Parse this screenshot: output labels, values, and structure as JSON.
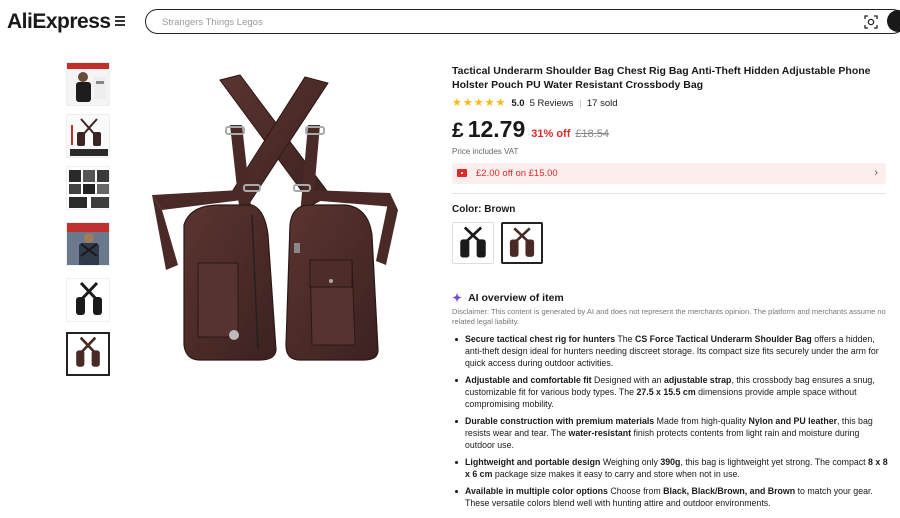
{
  "header": {
    "logo_text": "AliExpress",
    "search_placeholder": "Strangers Things Legos"
  },
  "product": {
    "title": "Tactical Underarm Shoulder Bag Chest Rig Bag Anti-Theft Hidden Adjustable Phone Holster Pouch PU Water Resistant Crossbody Bag",
    "rating": "5.0",
    "star_count": 5,
    "reviews": "5 Reviews",
    "sold": "17 sold",
    "currency": "£",
    "price": "12.79",
    "discount": "31% off",
    "original_price": "£18.54",
    "vat_note": "Price includes VAT",
    "coupon_text": "£2.00 off on £15.00",
    "color_label": "Color: Brown",
    "swatches": [
      "Black",
      "Brown"
    ],
    "selected_swatch": "Brown"
  },
  "ai_overview": {
    "heading": "AI overview of item",
    "disclaimer": "Disclaimer: This content is generated by AI and does not represent the merchants opinion. The platform and merchants assume no related legal liability.",
    "bullets": [
      {
        "parts": [
          {
            "b": "Secure tactical chest rig for hunters"
          },
          {
            "t": " The "
          },
          {
            "b": "CS Force Tactical Underarm Shoulder Bag"
          },
          {
            "t": " offers a hidden, anti-theft design ideal for hunters needing discreet storage. Its compact size fits securely under the arm for quick access during outdoor activities."
          }
        ]
      },
      {
        "parts": [
          {
            "b": "Adjustable and comfortable fit"
          },
          {
            "t": " Designed with an "
          },
          {
            "b": "adjustable strap"
          },
          {
            "t": ", this crossbody bag ensures a snug, customizable fit for various body types. The "
          },
          {
            "b": "27.5 x 15.5 cm"
          },
          {
            "t": " dimensions provide ample space without compromising mobility."
          }
        ]
      },
      {
        "parts": [
          {
            "b": "Durable construction with premium materials"
          },
          {
            "t": " Made from high-quality "
          },
          {
            "b": "Nylon and PU leather"
          },
          {
            "t": ", this bag resists wear and tear. The "
          },
          {
            "b": "water-resistant"
          },
          {
            "t": " finish protects contents from light rain and moisture during outdoor use."
          }
        ]
      },
      {
        "parts": [
          {
            "b": "Lightweight and portable design"
          },
          {
            "t": " Weighing only "
          },
          {
            "b": "390g"
          },
          {
            "t": ", this bag is lightweight yet strong. The compact "
          },
          {
            "b": "8 x 8 x 6 cm"
          },
          {
            "t": " package size makes it easy to carry and store when not in use."
          }
        ]
      },
      {
        "parts": [
          {
            "b": "Available in multiple color options"
          },
          {
            "t": " Choose from "
          },
          {
            "b": "Black, Black/Brown, and Brown"
          },
          {
            "t": " to match your gear. These versatile colors blend well with hunting attire and outdoor environments."
          }
        ]
      }
    ]
  },
  "thumbnails": [
    {
      "name": "model-front"
    },
    {
      "name": "dimensions"
    },
    {
      "name": "details-grid"
    },
    {
      "name": "model-wearing"
    },
    {
      "name": "black-variant"
    },
    {
      "name": "brown-variant"
    }
  ],
  "active_thumbnail": 5,
  "colors": {
    "accent_red": "#e02a2a",
    "star_yellow": "#fdb812",
    "ai_purple": "#7a4bd6",
    "bag_brown": "#4a2a26"
  }
}
